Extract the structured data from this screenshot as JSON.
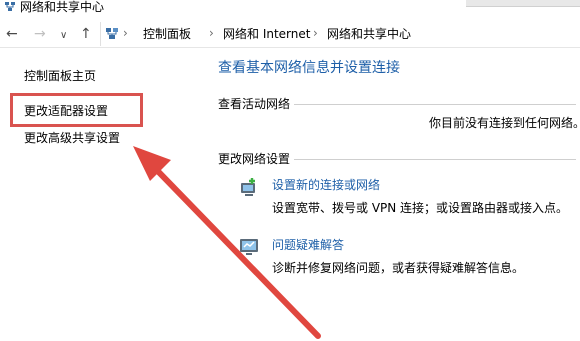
{
  "window": {
    "title": "网络和共享中心"
  },
  "address": {
    "nav": {
      "back": "←",
      "forward": "→",
      "recent": "∨",
      "up": "↑"
    },
    "crumbs": [
      "控制面板",
      "网络和 Internet",
      "网络和共享中心"
    ],
    "separator": "›"
  },
  "sidebar": {
    "items": [
      {
        "label": "控制面板主页"
      },
      {
        "label": "更改适配器设置"
      },
      {
        "label": "更改高级共享设置"
      }
    ]
  },
  "main": {
    "title": "查看基本网络信息并设置连接",
    "active_networks": {
      "label": "查看活动网络",
      "status": "你目前没有连接到任何网络。"
    },
    "change_settings": {
      "label": "更改网络设置",
      "tasks": [
        {
          "icon": "network-setup-icon",
          "link": "设置新的连接或网络",
          "desc": "设置宽带、拨号或 VPN 连接；或设置路由器或接入点。"
        },
        {
          "icon": "troubleshoot-icon",
          "link": "问题疑难解答",
          "desc": "诊断并修复网络问题，或者获得疑难解答信息。"
        }
      ]
    }
  },
  "annotation": {
    "highlight_color": "#d9534f",
    "arrow_color": "#e0473f"
  }
}
